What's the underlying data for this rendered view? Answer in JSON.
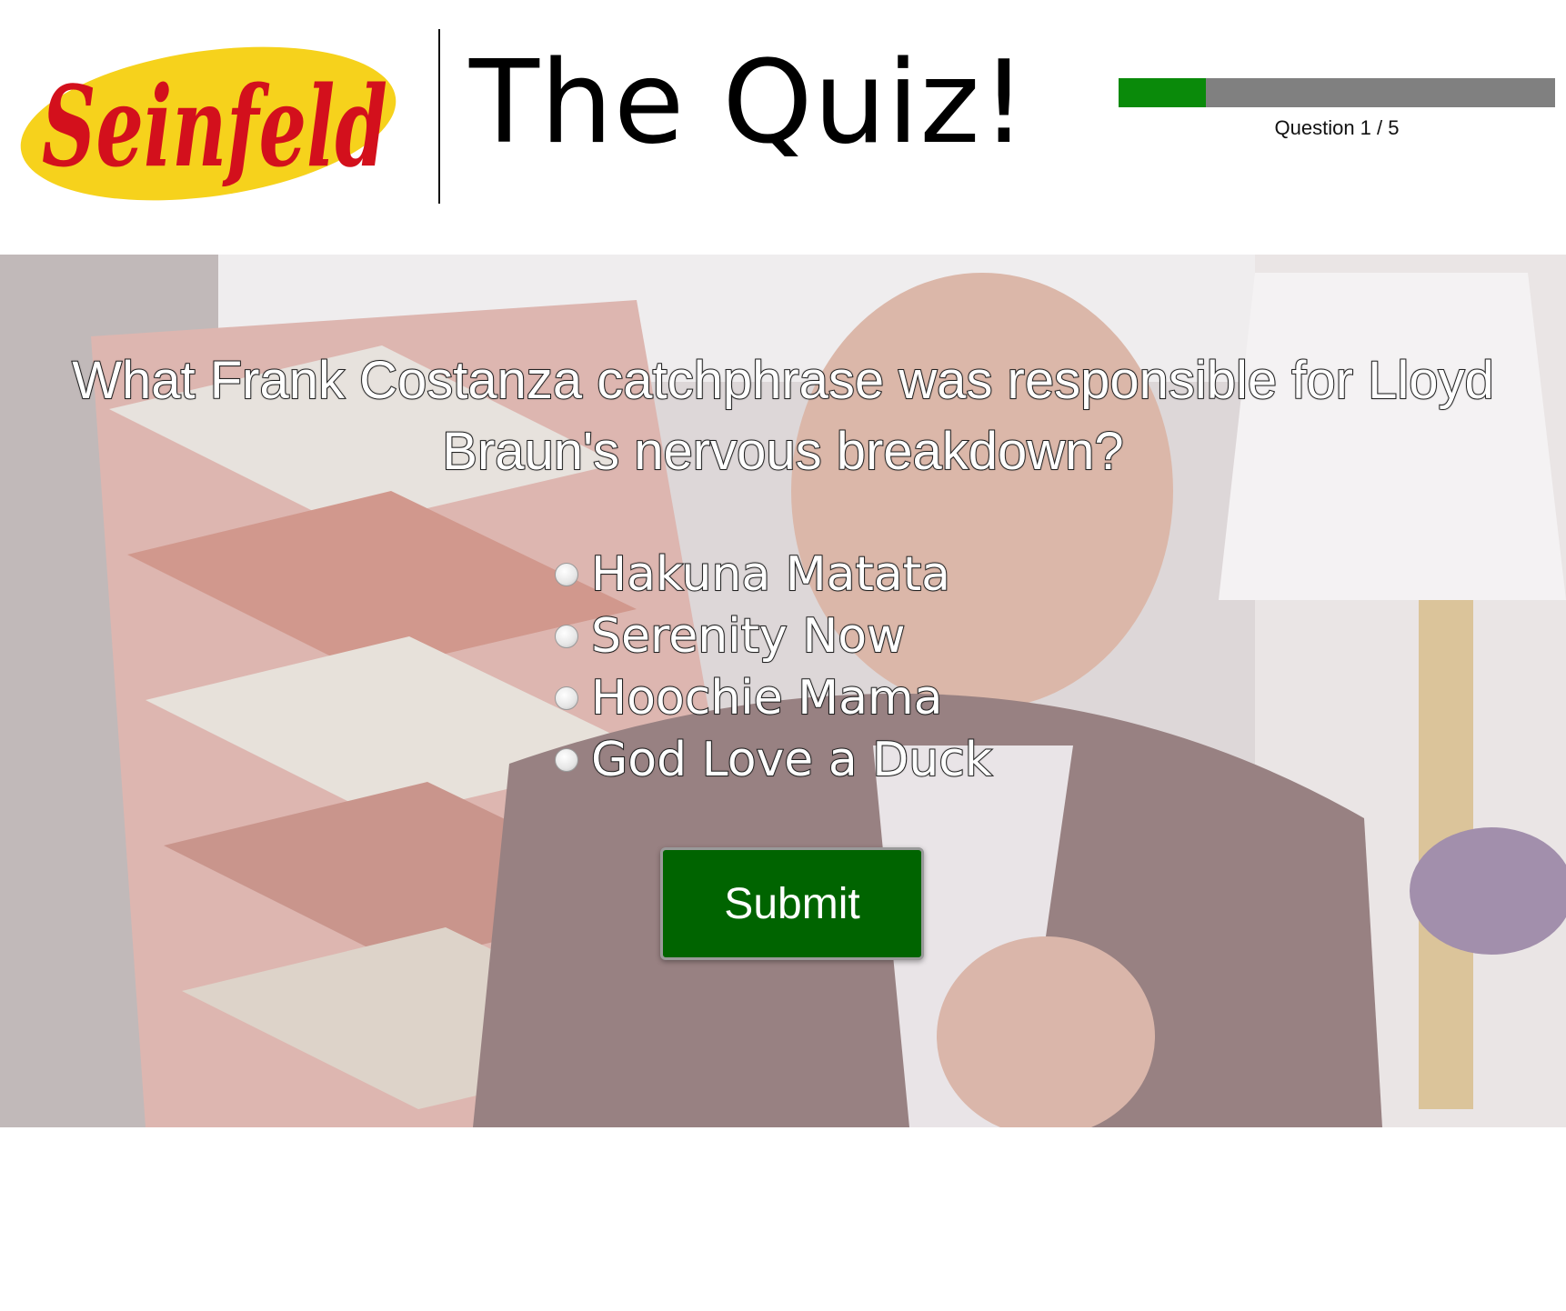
{
  "header": {
    "logo_text": "Seinfeld",
    "title": "The Quiz!",
    "progress": {
      "current": 1,
      "total": 5,
      "fraction": 0.2,
      "label": "Question 1 / 5",
      "fill_color": "#0a8a0a",
      "track_color": "#808080"
    }
  },
  "quiz": {
    "question": "What Frank Costanza catchphrase was responsible for Lloyd Braun's nervous breakdown?",
    "options": [
      {
        "label": "Hakuna Matata"
      },
      {
        "label": "Serenity Now"
      },
      {
        "label": "Hoochie Mama"
      },
      {
        "label": "God Love a Duck"
      }
    ],
    "submit_label": "Submit",
    "submit_color": "#006400"
  }
}
